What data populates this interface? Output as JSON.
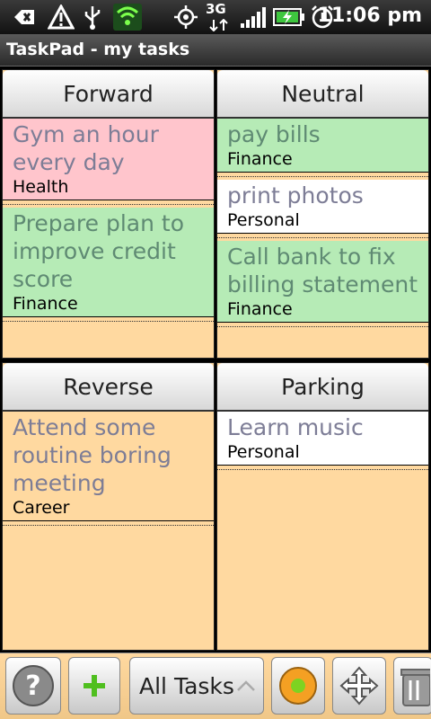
{
  "status": {
    "network": "3G",
    "time": "11:06 pm"
  },
  "app": {
    "title": "TaskPad - my tasks"
  },
  "quadrants": {
    "forward": {
      "label": "Forward",
      "tasks": [
        {
          "title": "Gym an hour every day",
          "category": "Health",
          "color": "#ffc5cc"
        },
        {
          "title": "Prepare plan to improve credit score",
          "category": "Finance",
          "color": "#b6ebb6"
        }
      ]
    },
    "neutral": {
      "label": "Neutral",
      "tasks": [
        {
          "title": "pay bills",
          "category": "Finance",
          "color": "#b6ebb6"
        },
        {
          "title": "print photos",
          "category": "Personal",
          "color": "#ffffff"
        },
        {
          "title": "Call bank to fix billing statement",
          "category": "Finance",
          "color": "#b6ebb6"
        }
      ]
    },
    "reverse": {
      "label": "Reverse",
      "tasks": [
        {
          "title": "Attend some routine boring meeting",
          "category": "Career",
          "color": "#ffd9a0"
        }
      ]
    },
    "parking": {
      "label": "Parking",
      "tasks": [
        {
          "title": "Learn music",
          "category": "Personal",
          "color": "#ffffff"
        }
      ]
    }
  },
  "toolbar": {
    "filter_selected": "All Tasks",
    "icons": [
      "help-icon",
      "add-icon",
      "record-icon",
      "expand-icon",
      "trash-icon"
    ]
  }
}
